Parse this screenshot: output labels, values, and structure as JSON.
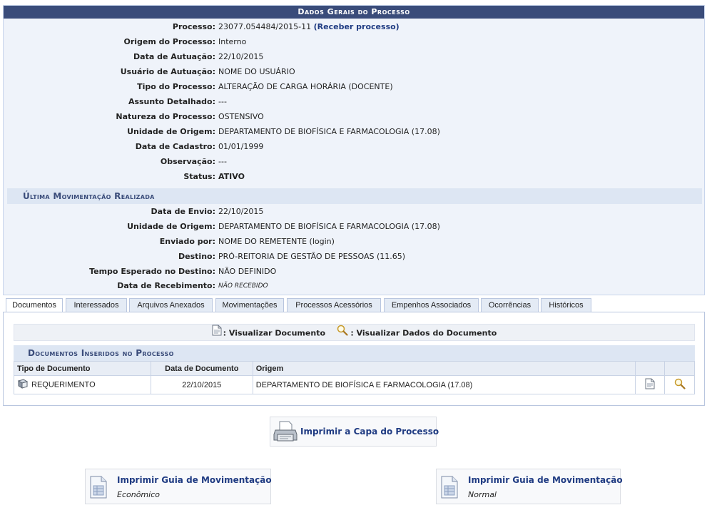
{
  "panel": {
    "title": "Dados Gerais do Processo",
    "fields": [
      {
        "label": "Processo:",
        "value": "23077.054484/2015-11",
        "link": "(Receber processo)"
      },
      {
        "label": "Origem do Processo:",
        "value": "Interno"
      },
      {
        "label": "Data de Autuação:",
        "value": "22/10/2015"
      },
      {
        "label": "Usuário de Autuação:",
        "value": "NOME DO USUÁRIO"
      },
      {
        "label": "Tipo do Processo:",
        "value": "ALTERAÇÃO DE CARGA HORÁRIA (DOCENTE)"
      },
      {
        "label": "Assunto Detalhado:",
        "value": "---"
      },
      {
        "label": "Natureza do Processo:",
        "value": "OSTENSIVO"
      },
      {
        "label": "Unidade de Origem:",
        "value": "DEPARTAMENTO DE BIOFÍSICA E FARMACOLOGIA (17.08)"
      },
      {
        "label": "Data de Cadastro:",
        "value": "01/01/1999"
      },
      {
        "label": "Observação:",
        "value": "---"
      },
      {
        "label": "Status:",
        "value": "ATIVO"
      }
    ],
    "movimentacao_title": "Última Movimentação Realizada",
    "movimentacao": [
      {
        "label": "Data de Envio:",
        "value": "22/10/2015"
      },
      {
        "label": "Unidade de Origem:",
        "value": "DEPARTAMENTO DE BIOFÍSICA E FARMACOLOGIA (17.08)"
      },
      {
        "label": "Enviado por:",
        "value": "NOME DO REMETENTE (login)"
      },
      {
        "label": "Destino:",
        "value": "PRÓ-REITORIA DE GESTÃO DE PESSOAS (11.65)"
      },
      {
        "label": "Tempo Esperado no Destino:",
        "value": "NÃO DEFINIDO"
      },
      {
        "label": "Data de Recebimento:",
        "value": "NÃO RECEBIDO"
      }
    ]
  },
  "tabs": [
    "Documentos",
    "Interessados",
    "Arquivos Anexados",
    "Movimentações",
    "Processos Acessórios",
    "Empenhos Associados",
    "Ocorrências",
    "Históricos"
  ],
  "legend": {
    "view_doc": ": Visualizar Documento",
    "view_data": ": Visualizar Dados do Documento"
  },
  "docs": {
    "title": "Documentos Inseridos no Processo",
    "columns": [
      "Tipo de Documento",
      "Data de Documento",
      "Origem"
    ],
    "rows": [
      {
        "tipo": "REQUERIMENTO",
        "data": "22/10/2015",
        "origem": "DEPARTAMENTO DE BIOFÍSICA E FARMACOLOGIA (17.08)"
      }
    ]
  },
  "actions": {
    "capa": "Imprimir a Capa do Processo",
    "guia_title": "Imprimir Guia de Movimentação",
    "guia_economico": "Econômico",
    "guia_normal": "Normal"
  }
}
